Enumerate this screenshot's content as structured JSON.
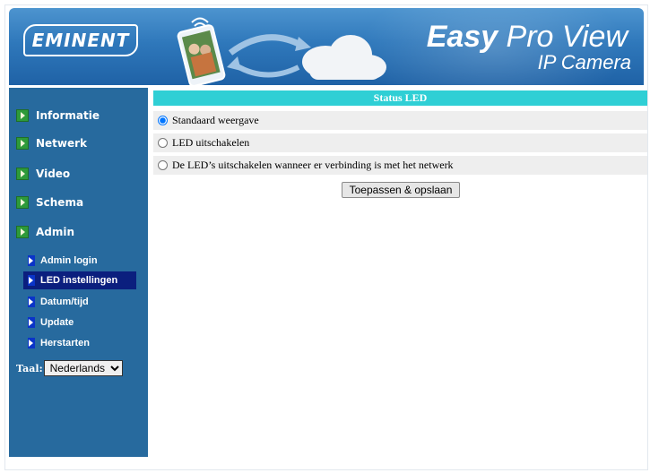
{
  "header": {
    "logo_text": "EMINENT",
    "brand_bold": "Easy",
    "brand_light": " Pro View",
    "brand_subtitle": "IP Camera"
  },
  "sidebar": {
    "menu": [
      {
        "label": "Informatie"
      },
      {
        "label": "Netwerk"
      },
      {
        "label": "Video"
      },
      {
        "label": "Schema"
      },
      {
        "label": "Admin"
      }
    ],
    "submenu": [
      {
        "label": "Admin login",
        "active": false
      },
      {
        "label": "LED instellingen",
        "active": true
      },
      {
        "label": "Datum/tijd",
        "active": false
      },
      {
        "label": "Update",
        "active": false
      },
      {
        "label": "Herstarten",
        "active": false
      }
    ],
    "language": {
      "label": "Taal:",
      "selected": "Nederlands"
    }
  },
  "main": {
    "section_title": "Status LED",
    "options": [
      {
        "label": "Standaard weergave",
        "checked": true
      },
      {
        "label": "LED uitschakelen",
        "checked": false
      },
      {
        "label": "De LED’s uitschakelen wanneer er verbinding is met het netwerk",
        "checked": false
      }
    ],
    "apply_label": "Toepassen & opslaan"
  },
  "colors": {
    "banner": "#2f78bb",
    "sidebar": "#276a9e",
    "section_header": "#2fcfd5",
    "active_item": "#0b1f7e",
    "option_row": "#eeeeee"
  }
}
